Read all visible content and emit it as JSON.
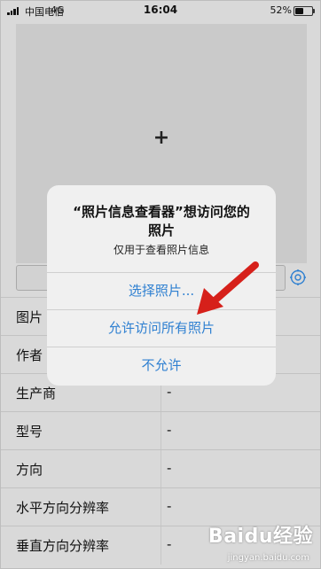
{
  "status_bar": {
    "carrier": "中国电信",
    "network": "4G",
    "time": "16:04",
    "battery_percent": "52%"
  },
  "photo_picker": {
    "add_symbol": "+"
  },
  "info_rows": [
    {
      "label": "图片",
      "value": ""
    },
    {
      "label": "作者",
      "value": ""
    },
    {
      "label": "生产商",
      "value": "-"
    },
    {
      "label": "型号",
      "value": "-"
    },
    {
      "label": "方向",
      "value": "-"
    },
    {
      "label": "水平方向分辨率",
      "value": "-"
    },
    {
      "label": "垂直方向分辨率",
      "value": "-"
    }
  ],
  "alert": {
    "title_line1": "“照片信息查看器”想访问您的",
    "title_line2": "照片",
    "message": "仅用于查看照片信息",
    "buttons": [
      "选择照片...",
      "允许访问所有照片",
      "不允许"
    ]
  },
  "annotation": {
    "arrow_color": "#d6201a"
  },
  "watermark": {
    "brand": "Baidu经验",
    "url": "jingyan.baidu.com"
  }
}
